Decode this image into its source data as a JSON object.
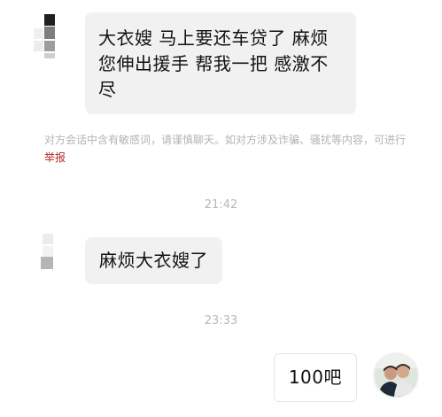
{
  "messages": [
    {
      "text": "大衣嫂 马上要还车贷了 麻烦您伸出援手 帮我一把 感激不尽"
    },
    {
      "text": "麻烦大衣嫂了"
    },
    {
      "text": "100吧"
    }
  ],
  "notice": {
    "text": "对方会话中含有敏感词，请谨慎聊天。如对方涉及诈骗、骚扰等内容，可进行",
    "link": "举报"
  },
  "timestamps": [
    "21:42",
    "23:33"
  ],
  "colors": {
    "bubble_incoming": "#f1f1f1",
    "notice_text": "#b3b3b3",
    "report_link": "#b22a2a",
    "timestamp": "#b8b8b8"
  }
}
